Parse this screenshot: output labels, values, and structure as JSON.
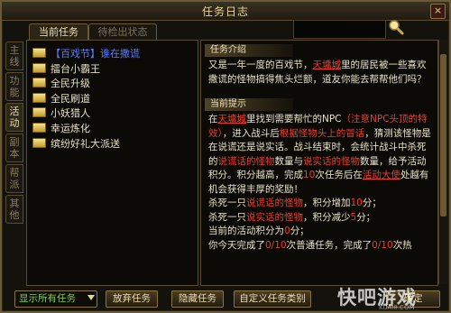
{
  "window": {
    "title": "任务日志",
    "close_glyph": "×"
  },
  "tabs": [
    {
      "label": "当前任务"
    },
    {
      "label": "待检出状态"
    }
  ],
  "side_tabs": [
    {
      "label": "主线"
    },
    {
      "label": "功能"
    },
    {
      "label": "活动"
    },
    {
      "label": "副本"
    },
    {
      "label": "帮派"
    },
    {
      "label": "其他"
    }
  ],
  "search": {
    "value": "",
    "placeholder": ""
  },
  "quests": [
    {
      "label": "【百戏节】谁在撒谎"
    },
    {
      "label": "擂台小霸王"
    },
    {
      "label": "全民升级"
    },
    {
      "label": "全民刷道"
    },
    {
      "label": "小妖猎人"
    },
    {
      "label": "幸运炼化"
    },
    {
      "label": "缤纷好礼大派送"
    }
  ],
  "detail": {
    "intro_header": "任务介绍",
    "intro": {
      "p1": "又是一年一度的百戏节，",
      "npc": "天墉城",
      "p2": "里的居民被一些喜欢撒谎的怪物搞得焦头烂额，道友你能去帮帮他们吗？"
    },
    "tips_header": "当前提示",
    "tips": {
      "s1": "在",
      "npc": "天墉城",
      "s2": "里找到需要帮忙的NPC",
      "note": "（注意NPC头顶的特效）",
      "s3": "，进入战斗后",
      "hint": "根据怪物头上的冒话",
      "s4": "，猜测该怪物是在说谎还是说实话。战斗结束时，会统计战斗中杀死的",
      "liar1": "说谎话的怪物",
      "s5": "数量与",
      "truth1": "说实话的怪物",
      "s6": "数量，给予活动积分。积分越高，完成",
      "count": "10",
      "s7": "次任务后在",
      "envoy": "活动大使",
      "s8": "处越有机会获得丰厚的奖励！",
      "r1a": "杀死一只",
      "r1b": "说谎话的怪物",
      "r1c": "，积分增加",
      "r1v": "10",
      "r1d": "分；",
      "r2a": "杀死一只",
      "r2b": "说实话的怪物",
      "r2c": "，积分减少",
      "r2v": "5",
      "r2d": "分；",
      "score_a": "当前的活动积分为",
      "score_v": "0",
      "score_b": "分；",
      "done_a": "你今天完成了",
      "done_v1": "0/10",
      "done_b": "次普通任务，完成了",
      "done_v2": "0/10",
      "done_c": "次热"
    }
  },
  "buttons": {
    "filter": "显示所有任务",
    "abandon": "放弃任务",
    "hide": "隐藏任务",
    "custom": "自定义任务类别",
    "confirm": "确定"
  },
  "watermark": {
    "brand": "快吧游戏",
    "url": "KUAI8.COM"
  },
  "colors": {
    "highlight": "#f03c2a",
    "selected_item": "#5b7dff",
    "filter_text": "#7fd34a",
    "gold": "#e9d49a"
  }
}
